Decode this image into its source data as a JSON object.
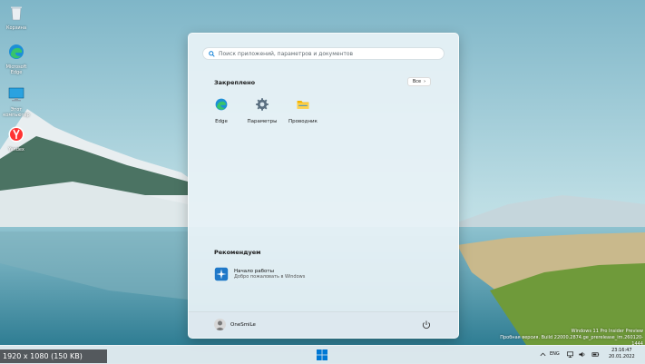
{
  "desktop": {
    "icons": [
      {
        "label": "Корзина",
        "icon": "recycle-bin-icon"
      },
      {
        "label": "Microsoft Edge",
        "icon": "edge-icon"
      },
      {
        "label": "Этот компьютер",
        "icon": "computer-icon"
      },
      {
        "label": "Yandex",
        "icon": "yandex-browser-icon"
      }
    ]
  },
  "start_menu": {
    "search_placeholder": "Поиск приложений, параметров и документов",
    "pinned_title": "Закреплено",
    "all_button_label": "Все",
    "pinned_apps": [
      {
        "label": "Edge",
        "icon": "edge-icon"
      },
      {
        "label": "Параметры",
        "icon": "settings-gear-icon"
      },
      {
        "label": "Проводник",
        "icon": "file-explorer-icon"
      }
    ],
    "recommended_title": "Рекомендуем",
    "recommended_items": [
      {
        "title": "Начало работы",
        "subtitle": "Добро пожаловать в Windows",
        "icon": "get-started-icon"
      }
    ],
    "user_name": "OneSmiLe"
  },
  "taskbar": {
    "language": "ENG",
    "time": "23:16:47",
    "date": "20.01.2022"
  },
  "watermark": {
    "line1": "Windows 11 Pro Insider Preview",
    "line2": "Пробная версия. Build 22000.2874.ge_prerelease_im.260120-1444"
  },
  "overlay": {
    "resolution": "1920 x 1080 (150 KB)"
  },
  "colors": {
    "accent": "#0078d4",
    "sky": "#8fc3d3",
    "water": "#5aa3b5"
  }
}
